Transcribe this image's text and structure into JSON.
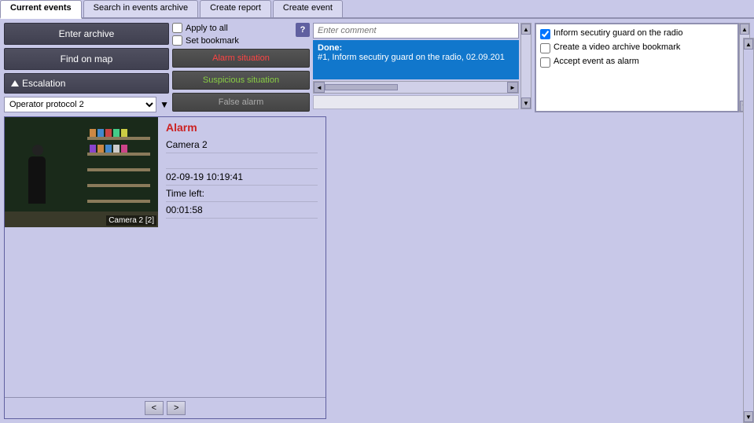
{
  "tabs": [
    {
      "label": "Current events",
      "active": true
    },
    {
      "label": "Search in events archive",
      "active": false
    },
    {
      "label": "Create report",
      "active": false
    },
    {
      "label": "Create event",
      "active": false
    }
  ],
  "buttons": {
    "enter_archive": "Enter archive",
    "find_on_map": "Find on map",
    "escalation": "Escalation",
    "alarm_situation": "Alarm situation",
    "suspicious_situation": "Suspicious situation",
    "false_alarm": "False alarm"
  },
  "checkboxes": {
    "apply_to_all": "Apply to all",
    "set_bookmark": "Set bookmark"
  },
  "help_btn": "?",
  "comment_placeholder": "Enter comment",
  "done": {
    "label": "Done:",
    "text": "#1, Inform secutiry guard on the radio, 02.09.201"
  },
  "right_checks": [
    {
      "checked": true,
      "label": "Inform secutiry guard on the radio"
    },
    {
      "checked": false,
      "label": "Create a video archive bookmark"
    },
    {
      "checked": false,
      "label": "Accept event as alarm"
    }
  ],
  "dropdown": {
    "value": "Operator protocol 2"
  },
  "event": {
    "alarm_label": "Alarm",
    "camera": "Camera 2",
    "empty_row": "",
    "datetime": "02-09-19 10:19:41",
    "time_left_label": "Time left:",
    "time_left": "00:01:58",
    "camera_label": "Camera 2 [2]",
    "nav_prev": "<",
    "nav_next": ">"
  }
}
